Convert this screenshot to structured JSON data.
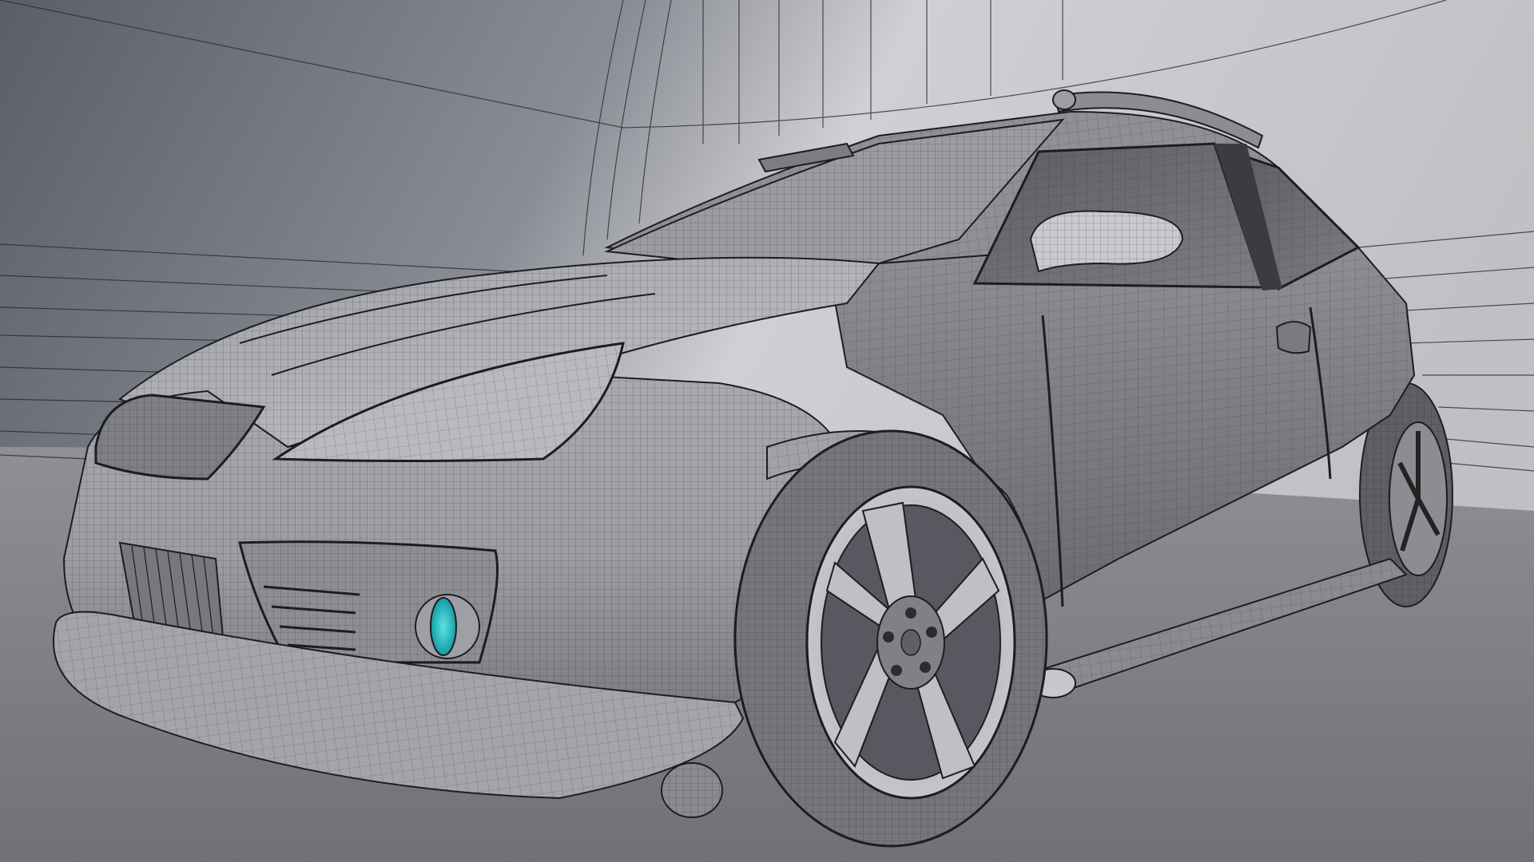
{
  "scene": {
    "subject": "hatchback-car-wireframe",
    "colors": {
      "backdrop_top": "#8d9099",
      "backdrop_light": "#d2d3d6",
      "floor": "#7b7d83",
      "body": "#9a9ba0",
      "body_light": "#c8c9cc",
      "body_shadow": "#55565b",
      "tire": "#6d6e73",
      "wire": "#1c1d21",
      "fog_lamp": "#27c3c8"
    }
  }
}
